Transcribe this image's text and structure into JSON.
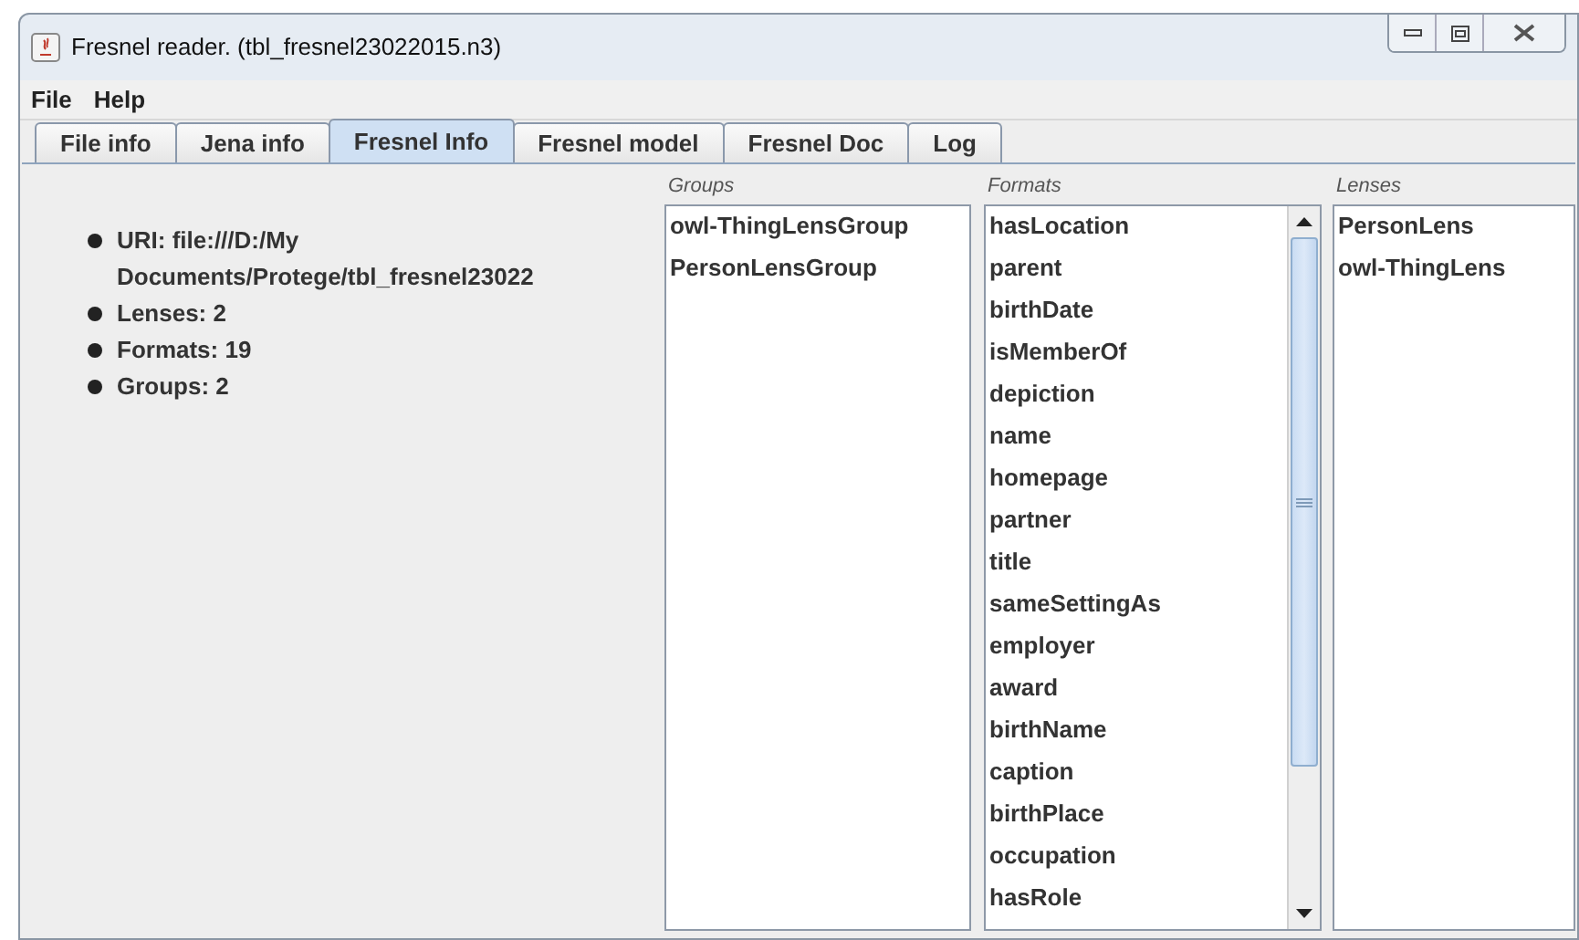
{
  "window": {
    "title": "Fresnel reader. (tbl_fresnel23022015.n3)"
  },
  "menu": [
    "File",
    "Help"
  ],
  "tabs": [
    {
      "label": "File info",
      "selected": false
    },
    {
      "label": "Jena info",
      "selected": false
    },
    {
      "label": "Fresnel Info",
      "selected": true
    },
    {
      "label": "Fresnel model",
      "selected": false
    },
    {
      "label": "Fresnel Doc",
      "selected": false
    },
    {
      "label": "Log",
      "selected": false
    }
  ],
  "info": [
    "URI: file:///D:/My Documents/Protege/tbl_fresnel23022",
    "Lenses: 2",
    "Formats: 19",
    "Groups: 2"
  ],
  "groups": {
    "label": "Groups",
    "items": [
      "owl-ThingLensGroup",
      "PersonLensGroup"
    ]
  },
  "formats": {
    "label": "Formats",
    "items": [
      "hasLocation",
      "parent",
      "birthDate",
      "isMemberOf",
      "depiction",
      "name",
      "homepage",
      "partner",
      "title",
      "sameSettingAs",
      "employer",
      "award",
      "birthName",
      "caption",
      "birthPlace",
      "occupation",
      "hasRole"
    ]
  },
  "lenses": {
    "label": "Lenses",
    "items": [
      "PersonLens",
      "owl-ThingLens"
    ]
  }
}
